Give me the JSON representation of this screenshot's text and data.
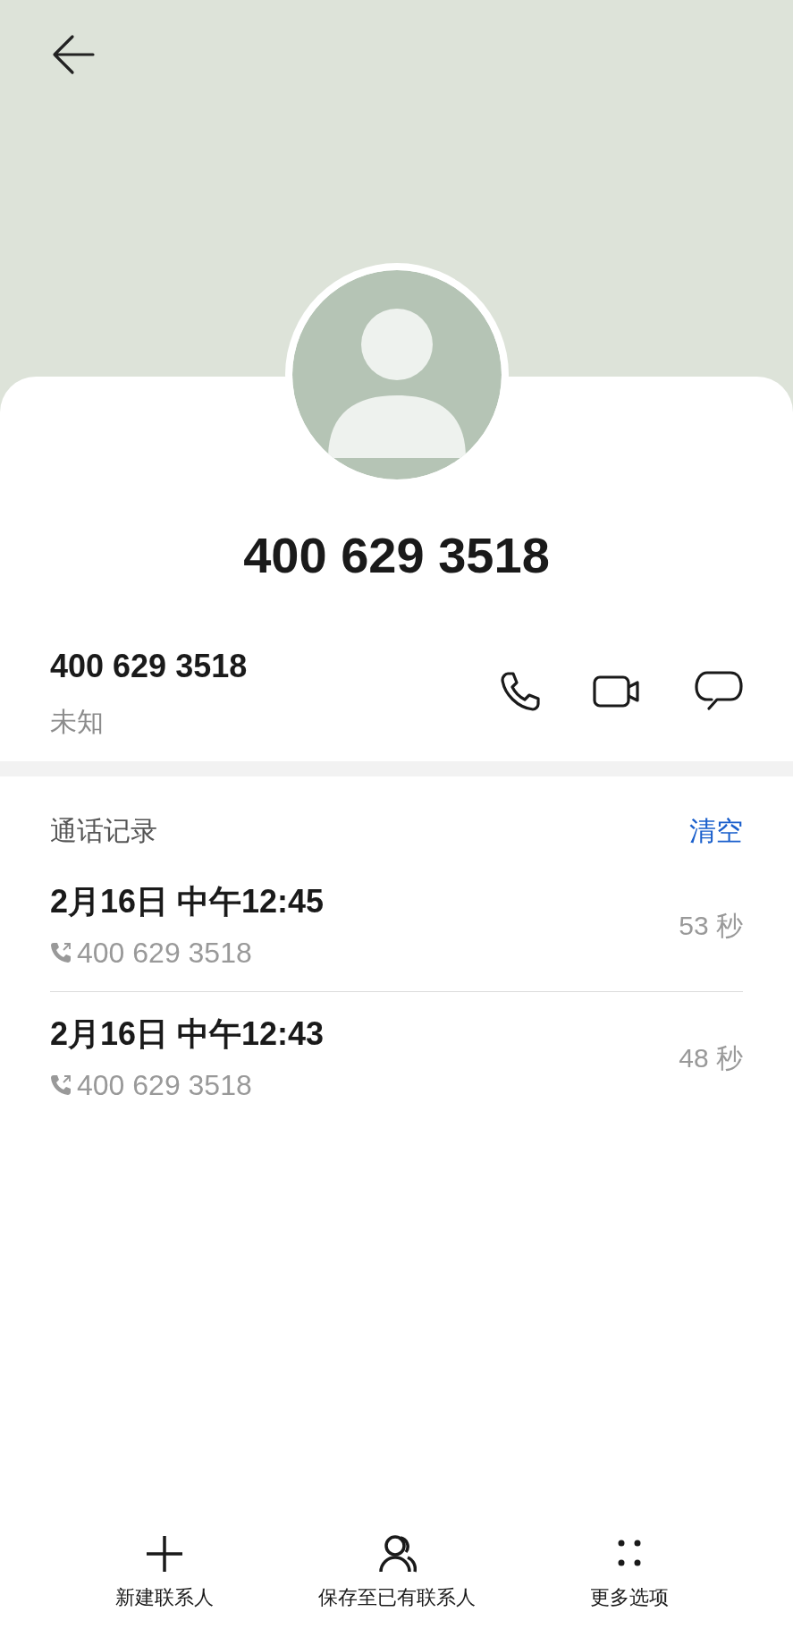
{
  "title": "400 629 3518",
  "contact": {
    "number": "400 629 3518",
    "label": "未知"
  },
  "call_log": {
    "title": "通话记录",
    "clear": "清空",
    "entries": [
      {
        "time": "2月16日 中午12:45",
        "number": "400 629 3518",
        "duration": "53 秒"
      },
      {
        "time": "2月16日 中午12:43",
        "number": "400 629 3518",
        "duration": "48 秒"
      }
    ]
  },
  "actions": [
    {
      "label": "新建联系人",
      "kind": "add"
    },
    {
      "label": "保存至已有联系人",
      "kind": "person"
    },
    {
      "label": "更多选项",
      "kind": "more"
    }
  ]
}
